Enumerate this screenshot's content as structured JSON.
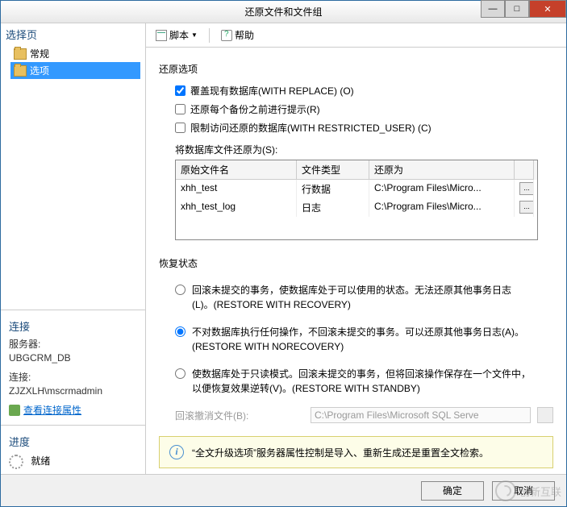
{
  "window": {
    "title": "还原文件和文件组"
  },
  "winbtns": {
    "min": "—",
    "max": "□",
    "close": "✕"
  },
  "sidebar": {
    "select_head": "选择页",
    "items": [
      {
        "label": "常规"
      },
      {
        "label": "选项"
      }
    ],
    "conn_head": "连接",
    "server_label": "服务器:",
    "server_val": "UBGCRM_DB",
    "conn_label": "连接:",
    "conn_val": "ZJZXLH\\mscrmadmin",
    "view_link": "查看连接属性",
    "progress_head": "进度",
    "progress_val": "就绪"
  },
  "toolbar": {
    "script": "脚本",
    "help": "帮助"
  },
  "content": {
    "restore_options": "还原选项",
    "cb_replace": "覆盖现有数据库(WITH REPLACE) (O)",
    "cb_prompt": "还原每个备份之前进行提示(R)",
    "cb_restricted": "限制访问还原的数据库(WITH RESTRICTED_USER) (C)",
    "files_label": "将数据库文件还原为(S):",
    "cols": {
      "c1": "原始文件名",
      "c2": "文件类型",
      "c3": "还原为"
    },
    "rows": [
      {
        "c1": "xhh_test",
        "c2": "行数据",
        "c3": "C:\\Program Files\\Micro..."
      },
      {
        "c1": "xhh_test_log",
        "c2": "日志",
        "c3": "C:\\Program Files\\Micro..."
      }
    ],
    "recovery_head": "恢复状态",
    "r1": "回滚未提交的事务，使数据库处于可以使用的状态。无法还原其他事务日志(L)。(RESTORE WITH RECOVERY)",
    "r2": "不对数据库执行任何操作，不回滚未提交的事务。可以还原其他事务日志(A)。(RESTORE WITH NORECOVERY)",
    "r3": "使数据库处于只读模式。回滚未提交的事务，但将回滚操作保存在一个文件中，以便恢复效果逆转(V)。(RESTORE WITH STANDBY)",
    "standby_label": "回滚撤消文件(B):",
    "standby_val": "C:\\Program Files\\Microsoft SQL Serve",
    "info": "“全文升级选项”服务器属性控制是导入、重新生成还是重置全文检索。"
  },
  "footer": {
    "ok": "确定",
    "cancel": "取消"
  },
  "watermark": "创新互联"
}
